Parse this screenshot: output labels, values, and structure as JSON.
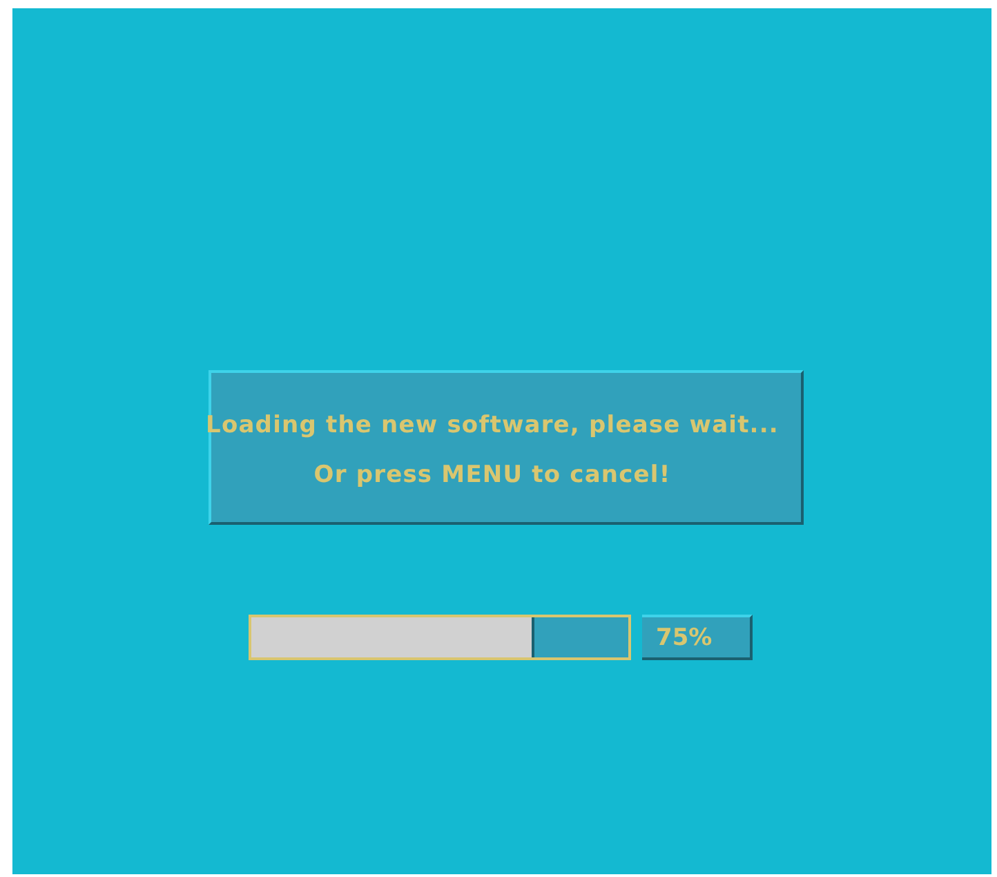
{
  "dialog": {
    "lines": [
      "Loading the new software, please wait...",
      "Or press MENU to cancel!"
    ]
  },
  "progress": {
    "level": 0.75,
    "reading": "75%"
  }
}
